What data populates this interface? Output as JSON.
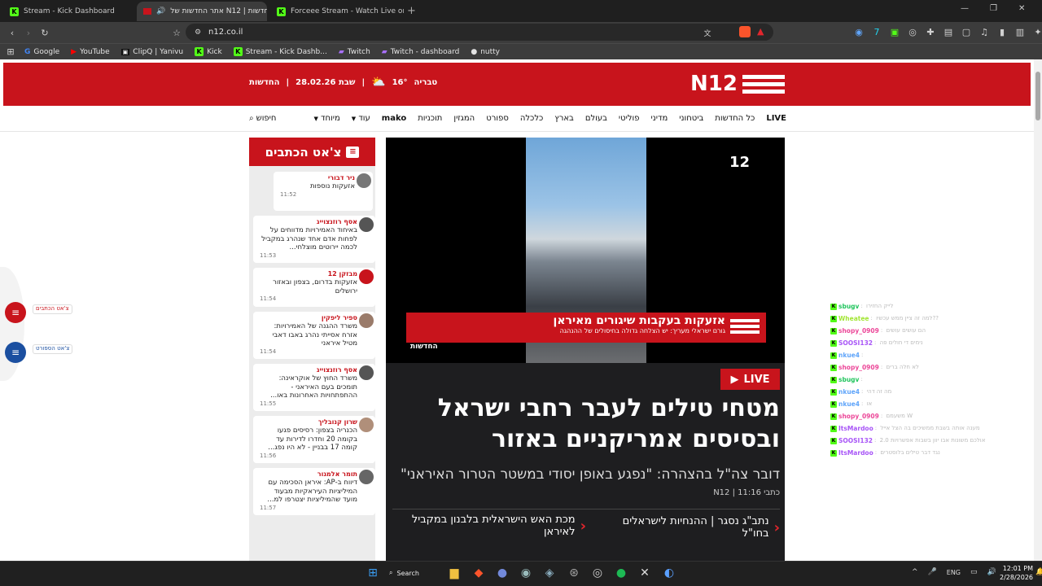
{
  "browser": {
    "tabs": [
      {
        "label": "Stream - Kick Dashboard",
        "active": false
      },
      {
        "label": "חדשות | N12 אתר החדשות של",
        "active": true
      },
      {
        "label": "Forceee Stream - Watch Live on Kick",
        "active": false
      }
    ],
    "url": "n12.co.il",
    "bookmarks": [
      "Google",
      "YouTube",
      "ClipQ | Yanivu",
      "Kick",
      "Stream - Kick Dashb...",
      "Twitch",
      "Twitch - dashboard",
      "nutty"
    ]
  },
  "site": {
    "logo": "N12",
    "weather": {
      "city": "טבריה",
      "temp": "16°",
      "date": "שבת 28.02.26",
      "section": "החדשות"
    },
    "nav": [
      "LIVE",
      "כל החדשות",
      "ביטחוני",
      "מדיני",
      "פוליטי",
      "בעולם",
      "בארץ",
      "כלכלה",
      "ספורט",
      "המגזין",
      "תוכניות",
      "mako",
      "עוד",
      "מיוחד",
      "חיפוש"
    ],
    "chat": {
      "title": "צ'אט הכתבים",
      "items": [
        {
          "name": "ניר דבורי",
          "text": "אזעקות נוספות",
          "time": "11:52"
        },
        {
          "name": "אסף רוזנצוייג",
          "text": "באיחוד האמירויות מדווחים על לפחות אדם אחד שנהרג במקביל לכמה יירוטים מוצלחי...",
          "time": "11:53"
        },
        {
          "name": "מבזקן 12",
          "text": "אזעקות בדרום, בצפון ובאזור ירושלים",
          "time": "11:54"
        },
        {
          "name": "ספיר ליפקין",
          "text": "משרד ההגנה של האמירויות: אזרח אסייתי נהרג באבו דאבי מטיל איראני",
          "time": "11:54"
        },
        {
          "name": "אסף רוזנצוייג",
          "text": "משרד החוץ של אוקראינה: תומכים בעם האיראני - ההתפתחויות האחרונות באו...",
          "time": "11:55"
        },
        {
          "name": "שרון קנובליך",
          "text": "הכנריה בצפון: רסיסים פגעו בקומה 20 וחדרו לדירות עד קומה 17 בבניין - לא היו נפג...",
          "time": "11:56"
        },
        {
          "name": "תומר אלמגור",
          "text": "דיווח ב-AP: איראן הסכימה עם המיליציות העיראקיות מבעוד מועד שהמיליציות יצטרפו למ...",
          "time": "11:57"
        }
      ]
    },
    "video": {
      "banner_title": "אזעקות בעקבות שיגורים מאיראן",
      "banner_sub": "גורם ישראלי מעריך: יש הצלחה גדולה בחיסולים של ההנהגה",
      "banner_brand": "החדשות",
      "badge": "12"
    },
    "article": {
      "live": "LIVE",
      "headline": "מטחי טילים לעבר רחבי ישראל ובסיסים אמריקניים באזור",
      "subline": "דובר צה\"ל בהצהרה: \"נפגע באופן יסודי במשטר הטרור האיראני\"",
      "byline": "כתבי N12 | 11:16",
      "related": [
        "נתב\"ג נסגר | ההנחיות לישראלים בחו\"ל",
        "מכת האש הישראלית בלבנון במקביל לאיראן"
      ]
    },
    "floating": [
      {
        "label": "צ'אט הכתבים",
        "color": "#c8141c"
      },
      {
        "label": "צ'אט הספורט",
        "color": "#1b4fa0"
      }
    ]
  },
  "stream_chat": [
    {
      "user": "sbugv",
      "msg": "לייק החזירו",
      "color": "#22c55e"
    },
    {
      "user": "Wheatee",
      "msg": "למה זה ציין ממש עכשיו??",
      "color": "#a3e635"
    },
    {
      "user": "shopy_0909",
      "msg": "הם עושים עושים",
      "color": "#ec4899"
    },
    {
      "user": "SOOSI132",
      "msg": "נימים די חולים פה",
      "color": "#a855f7"
    },
    {
      "user": "nkue4",
      "msg": "",
      "color": "#60a5fa"
    },
    {
      "user": "shopy_0909",
      "msg": "לא חלה ברים",
      "color": "#ec4899"
    },
    {
      "user": "sbugv",
      "msg": "",
      "color": "#22c55e"
    },
    {
      "user": "nkue4",
      "msg": "מה זה דהי",
      "color": "#60a5fa"
    },
    {
      "user": "nkue4",
      "msg": "או",
      "color": "#60a5fa"
    },
    {
      "user": "shopy_0909",
      "msg": "משעמם W",
      "color": "#ec4899"
    },
    {
      "user": "ItsMardoo",
      "msg": "מענה אותה בשבת ממשיכים בה הצל אייל",
      "color": "#a855f7"
    },
    {
      "user": "SOOSI132",
      "msg": "אולכם משונות אבו יוון בשבות אפשרויות 2.0",
      "color": "#a855f7"
    },
    {
      "user": "ItsMardoo",
      "msg": "נגד דבר טילים בלוסטרים",
      "color": "#a855f7"
    }
  ],
  "taskbar": {
    "search": "Search",
    "lang": "ENG",
    "time": "12:01 PM",
    "date": "2/28/2026"
  }
}
